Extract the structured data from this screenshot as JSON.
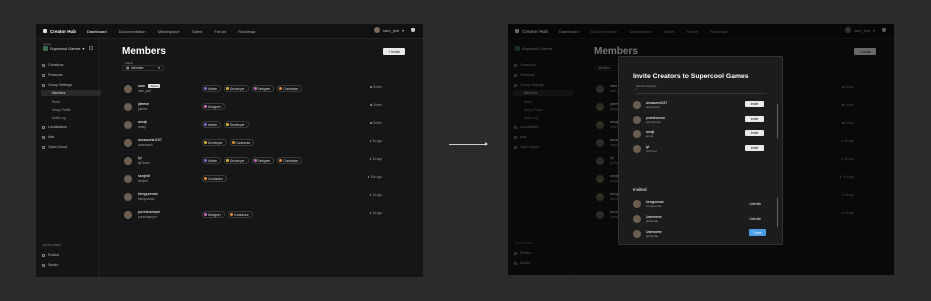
{
  "app": {
    "name": "Creator Hub",
    "nav": [
      "Dashboard",
      "Documentation",
      "Marketplace",
      "Talent",
      "Forum",
      "Roadmap"
    ],
    "active_nav": "Dashboard",
    "user": "sam_jedi"
  },
  "sidebar": {
    "group_label": "Group",
    "group_name": "Supercool Games",
    "items": [
      {
        "label": "Creations"
      },
      {
        "label": "Finances"
      },
      {
        "label": "Group Settings"
      }
    ],
    "subitems": [
      {
        "label": "Members",
        "active": true
      },
      {
        "label": "Roles"
      },
      {
        "label": "Group Profile"
      },
      {
        "label": "Audit Log"
      }
    ],
    "items_after": [
      {
        "label": "Localization"
      },
      {
        "label": "Ads"
      },
      {
        "label": "Open Cloud"
      }
    ],
    "quick_links_label": "QUICK LINKS",
    "quick_links": [
      "Roblox",
      "Studio"
    ]
  },
  "page": {
    "title": "Members",
    "invite_label": "Invite",
    "filter_label": "Status",
    "filter_value": "Member"
  },
  "members": [
    {
      "name": "sam",
      "handle": "sam_jedi",
      "owner": "Owner",
      "roles": [
        "Admin",
        "Developer",
        "Designer",
        "Contractor"
      ],
      "status": "Online"
    },
    {
      "name": "jdeese",
      "handle": "jdeese",
      "roles": [
        "Designer"
      ],
      "status": "Online"
    },
    {
      "name": "amaji",
      "handle": "amaji",
      "roles": [
        "Admin",
        "Developer"
      ],
      "status": "Online"
    },
    {
      "name": "amasuesh157",
      "handle": "amasuesh",
      "roles": [
        "Developer",
        "Contractor"
      ],
      "status": "3h ago"
    },
    {
      "name": "lyl",
      "handle": "lyl7lover",
      "roles": [
        "Admin",
        "Developer",
        "Designer",
        "Contractor"
      ],
      "status": "1h ago"
    },
    {
      "name": "ssnjedi",
      "handle": "ssnjedi",
      "roles": [
        "Contractor"
      ],
      "status": "10h ago"
    },
    {
      "name": "benguomax",
      "handle": "benguomax",
      "roles": [],
      "status": "1d ago"
    },
    {
      "name": "pureshamper",
      "handle": "pureshamper",
      "roles": [
        "Designer",
        "Contractor"
      ],
      "status": "1d ago"
    }
  ],
  "role_colors": {
    "Admin": "#7b6fd6",
    "Developer": "#e0b13c",
    "Designer": "#c96fc9",
    "Contractor": "#e08a3c"
  },
  "modal": {
    "title": "Invite Creators to Supercool Games",
    "search_label": "Search Creators",
    "search_placeholder": "",
    "creators": [
      {
        "name": "amasuesh157",
        "handle": "amasuesh",
        "action": "Invite"
      },
      {
        "name": "puresheman",
        "handle": "pureshman",
        "action": "Invite"
      },
      {
        "name": "amaji",
        "handle": "amaji",
        "action": "Invite"
      },
      {
        "name": "lyl",
        "handle": "lyl7lover",
        "action": "Invite"
      }
    ],
    "invited_heading": "Invited",
    "invited": [
      {
        "name": "benguomax",
        "handle": "benguomax",
        "action": "Uninvite"
      },
      {
        "name": "Username",
        "handle": "@handle",
        "action": "Uninvite"
      },
      {
        "name": "Username",
        "handle": "@handle",
        "action": "Uninvite"
      }
    ],
    "done_label": "Done"
  }
}
